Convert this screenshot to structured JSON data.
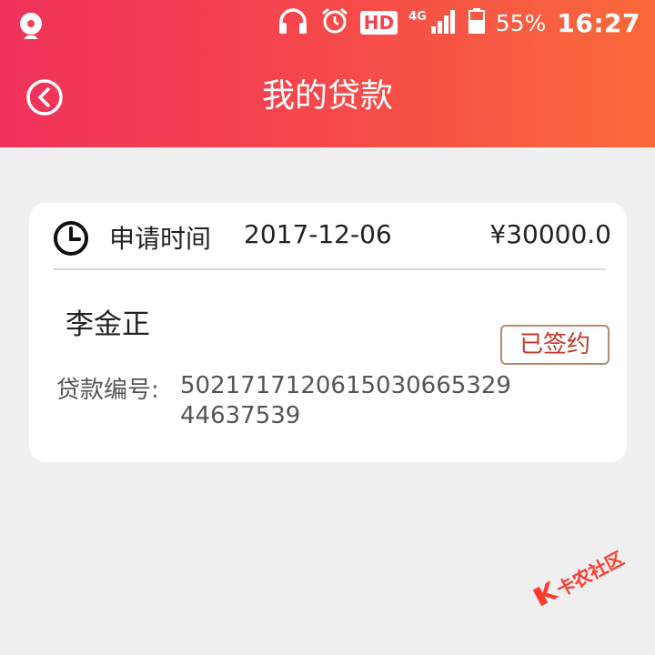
{
  "status_bar": {
    "hd": "HD",
    "network": "4G",
    "battery": "55%",
    "time": "16:27",
    "icons": [
      "app-notification-icon",
      "headphones-icon",
      "alarm-icon",
      "signal-icon",
      "battery-icon"
    ]
  },
  "app_bar": {
    "title": "我的贷款",
    "back_icon": "back-circle-icon"
  },
  "loan_card": {
    "apply_label": "申请时间",
    "apply_date": "2017-12-06",
    "amount": "¥30000.0",
    "borrower": "李金正",
    "status": "已签约",
    "loan_no_label": "贷款编号:",
    "loan_no": "502171712061503066532944637539"
  },
  "watermark": {
    "text": "卡农社区"
  },
  "colors": {
    "header_start": "#f0325b",
    "header_end": "#f96a3a",
    "background": "#efefef",
    "card": "#ffffff",
    "status_text": "#c0392b",
    "status_border": "#b9896b"
  }
}
